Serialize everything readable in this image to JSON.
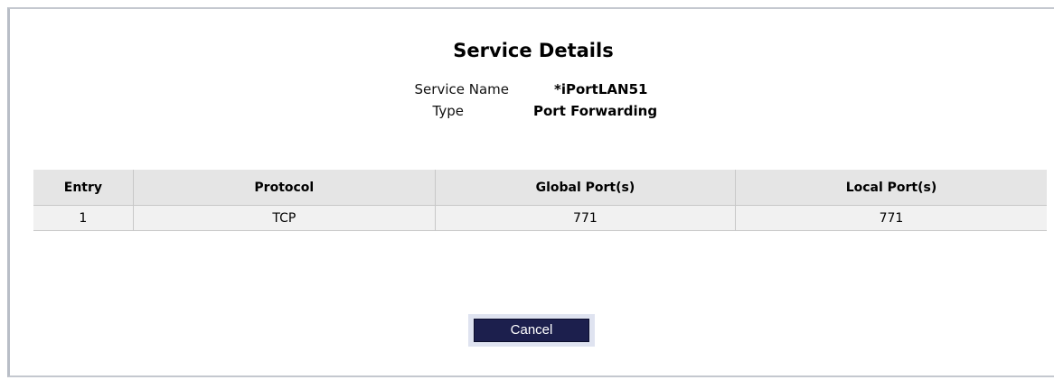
{
  "page": {
    "title": "Service Details"
  },
  "service": {
    "name_label": "Service Name",
    "name_value": "*iPortLAN51",
    "type_label": "Type",
    "type_value": "Port Forwarding"
  },
  "table": {
    "headers": [
      "Entry",
      "Protocol",
      "Global Port(s)",
      "Local Port(s)"
    ],
    "rows": [
      [
        "1",
        "TCP",
        "771",
        "771"
      ]
    ]
  },
  "actions": {
    "cancel_label": "Cancel"
  }
}
